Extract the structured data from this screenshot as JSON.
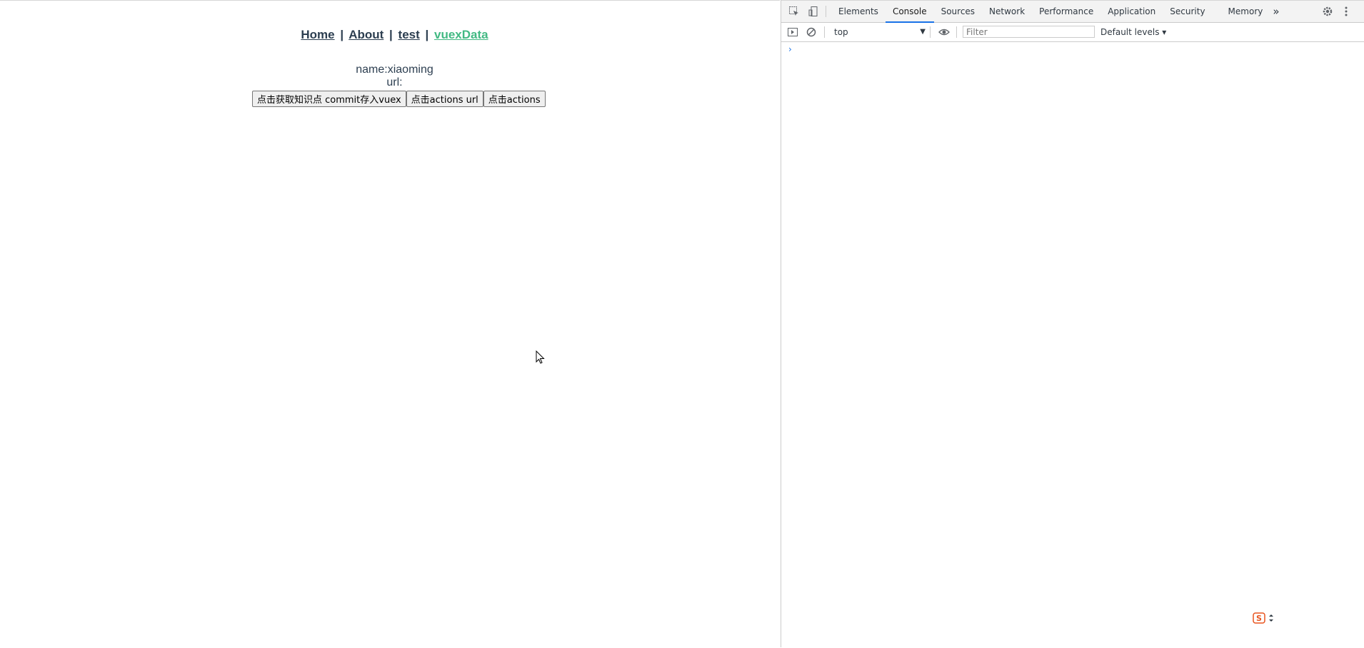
{
  "nav": {
    "links": [
      "Home",
      "About",
      "test",
      "vuexData"
    ],
    "separator": "|"
  },
  "info": {
    "name_line": "name:xiaoming",
    "url_line": "url:"
  },
  "buttons": {
    "commit": "点击获取知识点 commit存入vuex",
    "actions_url": "点击actions url",
    "actions": "点击actions"
  },
  "devtools": {
    "tabs": [
      "Elements",
      "Console",
      "Sources",
      "Network",
      "Performance",
      "Application",
      "Security",
      "Memory"
    ],
    "more": "»",
    "context": "top",
    "filter_placeholder": "Filter",
    "levels": "Default levels ▾",
    "prompt": "›",
    "colors": {
      "active_tab_underline": "#1a73e8",
      "active_link": "#42b983",
      "text": "#2c3e50"
    }
  }
}
